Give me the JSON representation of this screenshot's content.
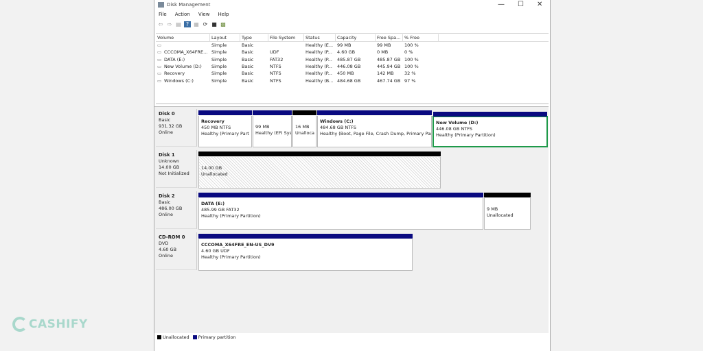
{
  "window": {
    "title": "Disk Management",
    "minimize": "—",
    "maximize": "☐",
    "close": "✕"
  },
  "menu": [
    "File",
    "Action",
    "View",
    "Help"
  ],
  "toolbar": [
    "back-icon",
    "forward-icon",
    "properties-icon",
    "help-icon",
    "view-icon",
    "refresh-icon",
    "disk-icon",
    "wizard-icon"
  ],
  "columns": [
    "Volume",
    "Layout",
    "Type",
    "File System",
    "Status",
    "Capacity",
    "Free Spa...",
    "% Free"
  ],
  "volumes": [
    [
      "",
      "Simple",
      "Basic",
      "",
      "Healthy (E...",
      "99 MB",
      "99 MB",
      "100 %"
    ],
    [
      "CCCOMA_X64FRE...",
      "Simple",
      "Basic",
      "UDF",
      "Healthy (P...",
      "4.60 GB",
      "0 MB",
      "0 %"
    ],
    [
      "DATA (E:)",
      "Simple",
      "Basic",
      "FAT32",
      "Healthy (P...",
      "485.87 GB",
      "485.87 GB",
      "100 %"
    ],
    [
      "New Volume (D:)",
      "Simple",
      "Basic",
      "NTFS",
      "Healthy (P...",
      "446.08 GB",
      "445.94 GB",
      "100 %"
    ],
    [
      "Recovery",
      "Simple",
      "Basic",
      "NTFS",
      "Healthy (P...",
      "450 MB",
      "142 MB",
      "32 %"
    ],
    [
      "Windows (C:)",
      "Simple",
      "Basic",
      "NTFS",
      "Healthy (B...",
      "484.68 GB",
      "467.74 GB",
      "97 %"
    ]
  ],
  "disks": [
    {
      "name": "Disk 0",
      "type": "Basic",
      "size": "931.32 GB",
      "status": "Online",
      "partitions": [
        {
          "name": "Recovery",
          "size": "450 MB NTFS",
          "status": "Healthy (Primary Part"
        },
        {
          "name": "",
          "size": "99 MB",
          "status": "Healthy (EFI Sys"
        },
        {
          "name": "",
          "size": "16 MB",
          "status": "Unalloca"
        },
        {
          "name": "Windows  (C:)",
          "size": "484.68 GB NTFS",
          "status": "Healthy (Boot, Page File, Crash Dump, Primary Par"
        },
        {
          "name": "New Volume  (D:)",
          "size": "446.08 GB NTFS",
          "status": "Healthy (Primary Partition)"
        }
      ]
    },
    {
      "name": "Disk 1",
      "type": "Unknown",
      "size": "14.00 GB",
      "status": "Not Initialized",
      "partitions": [
        {
          "name": "",
          "size": "14.00 GB",
          "status": "Unallocated"
        }
      ]
    },
    {
      "name": "Disk 2",
      "type": "Basic",
      "size": "486.00 GB",
      "status": "Online",
      "partitions": [
        {
          "name": "DATA  (E:)",
          "size": "485.99 GB FAT32",
          "status": "Healthy (Primary Partition)"
        },
        {
          "name": "",
          "size": "9 MB",
          "status": "Unallocated"
        }
      ]
    },
    {
      "name": "CD-ROM 0",
      "type": "DVD",
      "size": "4.60 GB",
      "status": "Online",
      "partitions": [
        {
          "name": "CCCOMA_X64FRE_EN-US_DV9",
          "size": "4.60 GB UDF",
          "status": "Healthy (Primary Partition)"
        }
      ]
    }
  ],
  "legend": {
    "unallocated": "Unallocated",
    "primary": "Primary partition"
  },
  "colors": {
    "primary": "#0a0a80",
    "unallocated": "#000000",
    "selected": "#1f9a4a"
  },
  "watermark": "CASHIFY"
}
